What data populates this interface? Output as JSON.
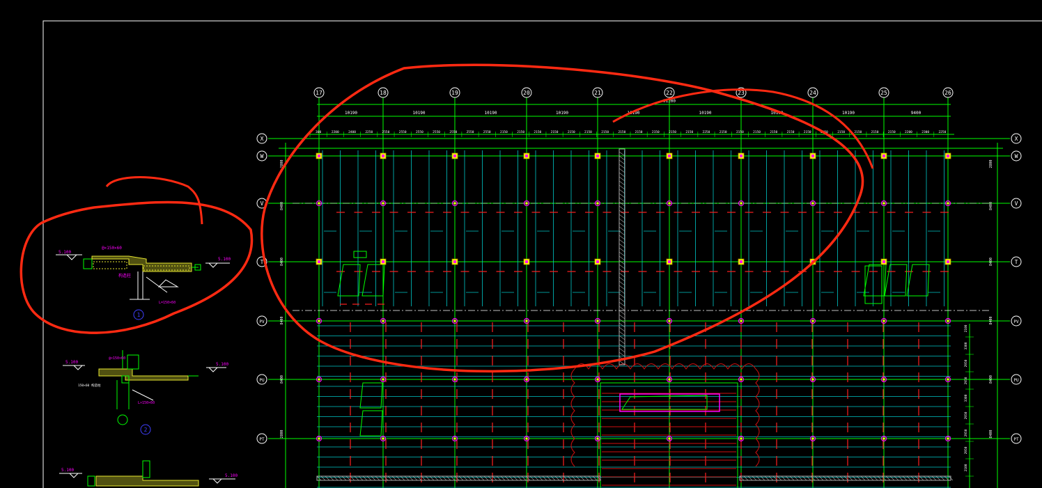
{
  "drawing": {
    "grid_columns": [
      "17",
      "18",
      "19",
      "20",
      "21",
      "22",
      "23",
      "24",
      "25",
      "26"
    ],
    "grid_rows": [
      "X",
      "W",
      "V",
      "T",
      "PV",
      "PU",
      "PT"
    ],
    "total_dimension": "91200",
    "bay_dimensions": [
      "10190",
      "10190",
      "10190",
      "10190",
      "10190",
      "10190",
      "10190",
      "10190",
      "9400"
    ],
    "rib_spacings": [
      "300",
      "2200",
      "2400",
      "2250",
      "2550",
      "2550",
      "2550",
      "2550",
      "2550",
      "2550",
      "2550",
      "2150",
      "2150",
      "2150",
      "2150",
      "2150",
      "2150",
      "2150",
      "2150",
      "2150",
      "2150",
      "2150",
      "2150",
      "2250",
      "2150",
      "2150",
      "2150",
      "2150",
      "2150",
      "2150",
      "2150",
      "2150",
      "2150",
      "2150",
      "2150",
      "2200",
      "2300",
      "2250"
    ],
    "left_row_dimensions": [
      "2800",
      "8400",
      "8400",
      "8400",
      "8400",
      "2800"
    ],
    "right_row_dimensions": [
      "2800",
      "8400",
      "8400",
      "8400",
      "8400",
      "8400"
    ],
    "right_small_dimensions": [
      "2100",
      "3300",
      "2950",
      "2950",
      "3300",
      "2950",
      "2950",
      "2950",
      "2100"
    ],
    "details": [
      {
        "id": "1",
        "left_level": "5.100",
        "right_level": "5.100",
        "top_note": "@×150×60",
        "mid_note": "构造柱",
        "bottom_note": "L=150×60"
      },
      {
        "id": "2",
        "left_level": "5.100",
        "right_level": "5.100",
        "top_note": "@×150×60",
        "mid_note": "L×150×60",
        "side_note": "150×60 构造柱"
      },
      {
        "id": "",
        "left_level": "5.100",
        "right_level": "5.100"
      }
    ]
  },
  "colors": {
    "background": "#000000",
    "frame": "#ffffff",
    "grid_line": "#00ff00",
    "grid_bubble": "#ffffff",
    "joist": "#00c8c8",
    "rebar_arrow": "#ff2020",
    "column_fill": "#ffff00",
    "column_mark": "#ff00ff",
    "markup": "#ff2a12",
    "dimension_text": "#ffffff",
    "detail_concrete": "#e8e830",
    "detail_text": "#ff00ff",
    "detail_circle": "#4040ff"
  }
}
